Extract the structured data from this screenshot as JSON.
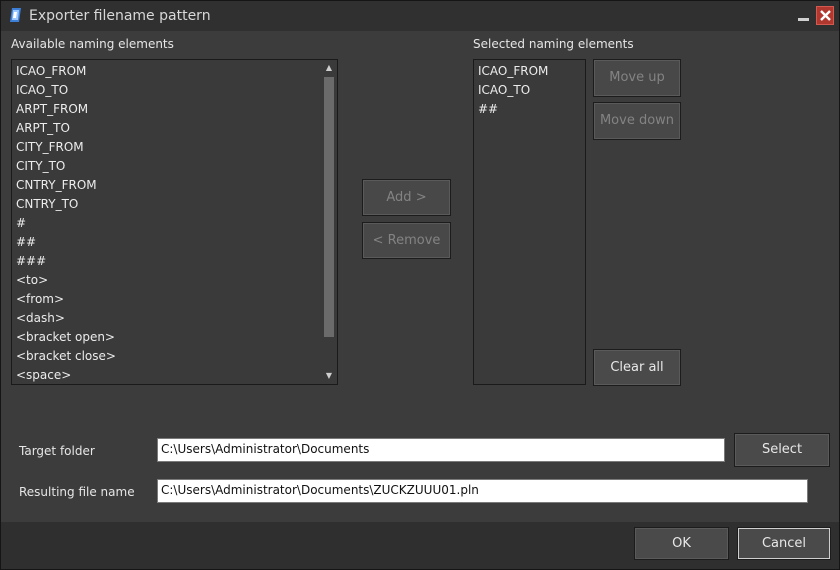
{
  "window": {
    "title": "Exporter filename pattern"
  },
  "available": {
    "label": "Available naming elements",
    "items": [
      "ICAO_FROM",
      "ICAO_TO",
      "ARPT_FROM",
      "ARPT_TO",
      "CITY_FROM",
      "CITY_TO",
      "CNTRY_FROM",
      "CNTRY_TO",
      "#",
      "##",
      "###",
      "<to>",
      "<from>",
      "<dash>",
      "<bracket open>",
      "<bracket close>",
      "<space>"
    ]
  },
  "selected": {
    "label": "Selected naming elements",
    "items": [
      "ICAO_FROM",
      "ICAO_TO",
      "##"
    ]
  },
  "buttons": {
    "add": "Add >",
    "remove": "< Remove",
    "move_up": "Move up",
    "move_down": "Move down",
    "clear_all": "Clear all",
    "select": "Select",
    "ok": "OK",
    "cancel": "Cancel"
  },
  "target_folder": {
    "label": "Target folder",
    "value": "C:\\Users\\Administrator\\Documents"
  },
  "resulting_file": {
    "label": "Resulting file name",
    "value": "C:\\Users\\Administrator\\Documents\\ZUCKZUUU01.pln"
  }
}
